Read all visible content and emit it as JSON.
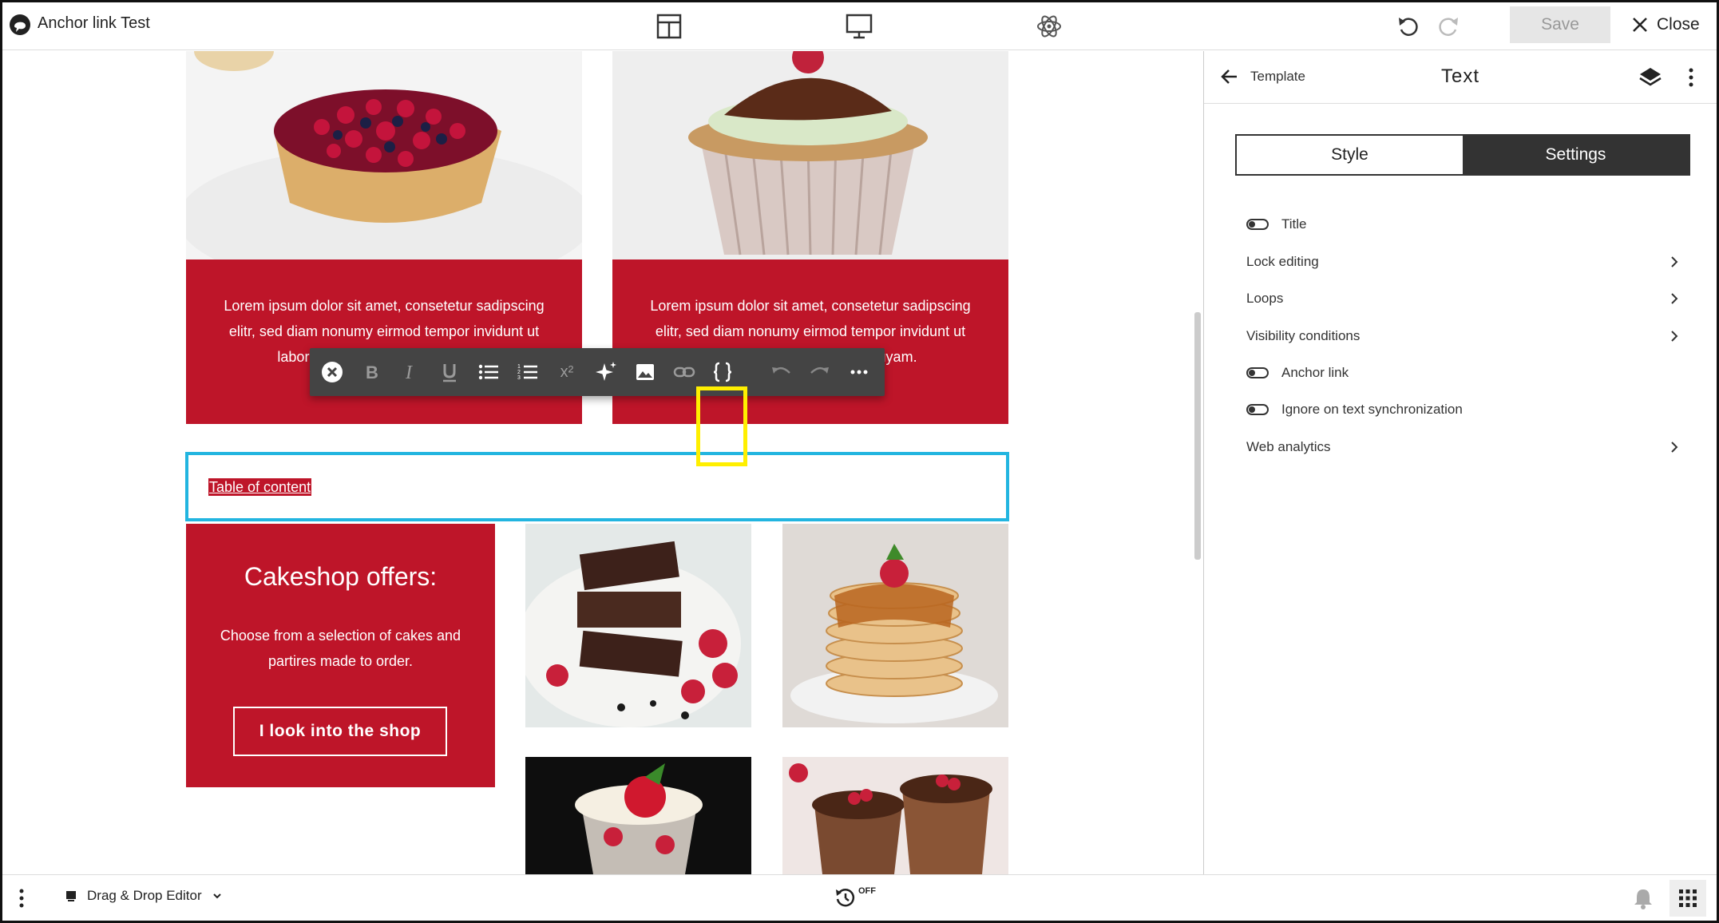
{
  "header": {
    "title": "Anchor link Test",
    "save_label": "Save",
    "close_label": "Close",
    "icons": [
      "layout-icon",
      "desktop-icon",
      "atom-icon",
      "undo-icon",
      "redo-icon"
    ]
  },
  "canvas": {
    "card1_text": "Lorem ipsum dolor sit amet, consetetur sadipscing elitr, sed diam nonumy eirmod tempor invidunt ut labore et dolore magna aliquyam.",
    "card2_text": "Lorem ipsum dolor sit amet, consetetur sadipscing elitr, sed diam nonumy eirmod tempor invidunt ut labore et dolore magna aliquyam.",
    "selected_text": "Table of content",
    "promo": {
      "heading": "Cakeshop offers:",
      "body": "Choose from a selection of cakes and partires made to order.",
      "button": "I look into the shop"
    }
  },
  "toolbar": {
    "buttons": [
      "clear-format",
      "bold",
      "italic",
      "underline",
      "bullet-list",
      "numbered-list",
      "superscript",
      "ai-sparkle",
      "image",
      "link",
      "placeholder-braces",
      "undo",
      "redo",
      "more"
    ],
    "superscript_label": "x²"
  },
  "panel": {
    "back_label": "Template",
    "title": "Text",
    "tabs": [
      {
        "label": "Style",
        "active": false
      },
      {
        "label": "Settings",
        "active": true
      }
    ],
    "settings": [
      {
        "label": "Title",
        "kind": "toggle"
      },
      {
        "label": "Lock editing",
        "kind": "chevron"
      },
      {
        "label": "Loops",
        "kind": "chevron"
      },
      {
        "label": "Visibility conditions",
        "kind": "chevron"
      },
      {
        "label": "Anchor link",
        "kind": "toggle"
      },
      {
        "label": "Ignore on text synchronization",
        "kind": "toggle"
      },
      {
        "label": "Web analytics",
        "kind": "chevron"
      }
    ]
  },
  "footer": {
    "editor_label": "Drag & Drop Editor",
    "autosave_label": "OFF"
  },
  "colors": {
    "accent_red": "#be1529",
    "selection_blue": "#22b5e0",
    "highlight_yellow": "#ffef00",
    "toolbar_bg": "#444444",
    "active_tab": "#333333"
  }
}
